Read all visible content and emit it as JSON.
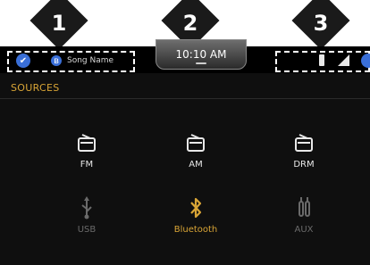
{
  "callouts": [
    "1",
    "2",
    "3"
  ],
  "status_bar": {
    "song_name": "Song Name",
    "time": "10:10 AM"
  },
  "section_title": "SOURCES",
  "sources": {
    "fm": {
      "label": "FM",
      "icon": "radio-icon",
      "state": "enabled"
    },
    "am": {
      "label": "AM",
      "icon": "radio-icon",
      "state": "enabled"
    },
    "drm": {
      "label": "DRM",
      "icon": "radio-icon",
      "state": "enabled"
    },
    "usb": {
      "label": "USB",
      "icon": "usb-icon",
      "state": "disabled"
    },
    "bluetooth": {
      "label": "Bluetooth",
      "icon": "bluetooth-icon",
      "state": "active"
    },
    "aux": {
      "label": "AUX",
      "icon": "aux-cable-icon",
      "state": "disabled"
    }
  },
  "colors": {
    "accent": "#d9a536",
    "background": "#0f0f0f",
    "disabled": "#6a6a6a"
  }
}
